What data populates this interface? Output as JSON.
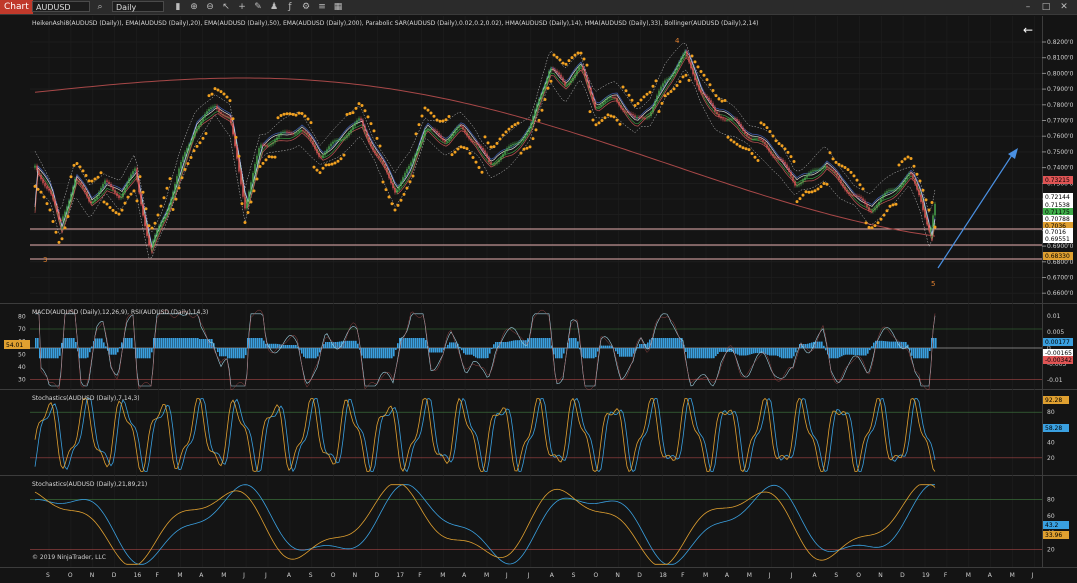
{
  "toolbar": {
    "tab_label": "Chart",
    "instrument": "AUDUSD",
    "interval": "Daily",
    "icons": [
      "search-icon",
      "bar-chart-icon",
      "zoom-in-icon",
      "zoom-out-icon",
      "pointer-icon",
      "crosshair-icon",
      "drawing-tools-icon",
      "strategy-icon",
      "add-indicator-icon",
      "properties-icon",
      "list-icon",
      "chart-style-icon"
    ]
  },
  "window": {
    "icons": [
      "minimize-icon",
      "maximize-icon",
      "close-icon"
    ]
  },
  "panels": {
    "price": {
      "label": "HeikenAshi8(AUDUSD (Daily)), EMA(AUDUSD (Daily),20), EMA(AUDUSD (Daily),50), EMA(AUDUSD (Daily),200), Parabolic SAR(AUDUSD (Daily),0.02,0.2,0.02), HMA(AUDUSD (Daily),14), HMA(AUDUSD (Daily),33), Bollinger(AUDUSD (Daily),2,14)",
      "ticks": [
        "0.8200'0",
        "0.8100'0",
        "0.8000'0",
        "0.7900'0",
        "0.7800'0",
        "0.7700'0",
        "0.7600'0",
        "0.7500'0",
        "0.7400'0",
        "0.7300'0",
        "0.7200'0",
        "0.7100'0",
        "0.7000'0",
        "0.6900'0",
        "0.6800'0",
        "0.6700'0",
        "0.6600'0"
      ],
      "tags": [
        {
          "text": "0.73215",
          "color": "#e05555"
        },
        {
          "text": "0.72144",
          "color": "#ffffff"
        },
        {
          "text": "0.71538",
          "color": "#ffffff"
        },
        {
          "text": "0.71175",
          "color": "#3fae4a"
        },
        {
          "text": "0.70788",
          "color": "#ffffff"
        },
        {
          "text": "0.7036",
          "color": "#e0a030"
        },
        {
          "text": "0.7016",
          "color": "#ffffff"
        },
        {
          "text": "0.69551",
          "color": "#ffffff"
        },
        {
          "text": "0.68330",
          "color": "#e0a030"
        }
      ],
      "wave_labels": [
        "4",
        "3",
        "5"
      ]
    },
    "macd": {
      "label": "MACD(AUDUSD (Daily),12,26,9), RSI(AUDUSD (Daily),14,3)",
      "left_ticks": [
        "80",
        "70",
        "60",
        "50",
        "40",
        "30"
      ],
      "right_ticks": [
        "0.01",
        "0.005",
        "0",
        "-0.005",
        "-0.01"
      ],
      "rsi_tag": "54.01",
      "tags": [
        {
          "text": "0.00177",
          "color": "#3aa0e0"
        },
        {
          "text": "-0.00165",
          "color": "#ffffff"
        },
        {
          "text": "-0.00342",
          "color": "#e05555"
        }
      ]
    },
    "stoch1": {
      "label": "Stochastics(AUDUSD (Daily),7,14,3)",
      "ticks": [
        "80",
        "60",
        "40",
        "20"
      ],
      "tags": [
        {
          "text": "92.28",
          "color": "#e0a030"
        },
        {
          "text": "58.28",
          "color": "#3aa0e0"
        }
      ]
    },
    "stoch2": {
      "label": "Stochastics(AUDUSD (Daily),21,89,21)",
      "ticks": [
        "80",
        "60",
        "40",
        "20"
      ],
      "tags": [
        {
          "text": "43.2",
          "color": "#3aa0e0"
        },
        {
          "text": "33.96",
          "color": "#e0a030"
        }
      ]
    }
  },
  "x_axis": {
    "labels": [
      "S",
      "O",
      "N",
      "D",
      "16",
      "F",
      "M",
      "A",
      "M",
      "J",
      "J",
      "A",
      "S",
      "O",
      "N",
      "D",
      "17",
      "F",
      "M",
      "A",
      "M",
      "J",
      "J",
      "A",
      "S",
      "O",
      "N",
      "D",
      "18",
      "F",
      "M",
      "A",
      "M",
      "J",
      "J",
      "A",
      "S",
      "O",
      "N",
      "D",
      "19",
      "F",
      "M",
      "A",
      "M",
      "J"
    ]
  },
  "copyright": "© 2019 NinjaTrader, LLC",
  "colors": {
    "background": "#141414",
    "sar": "#f0a020",
    "bull": "#4caf50",
    "bear": "#e05555",
    "macd_hist": "#3aa0e0",
    "stoch_k": "#e0a030",
    "stoch_d": "#3aa0e0"
  }
}
